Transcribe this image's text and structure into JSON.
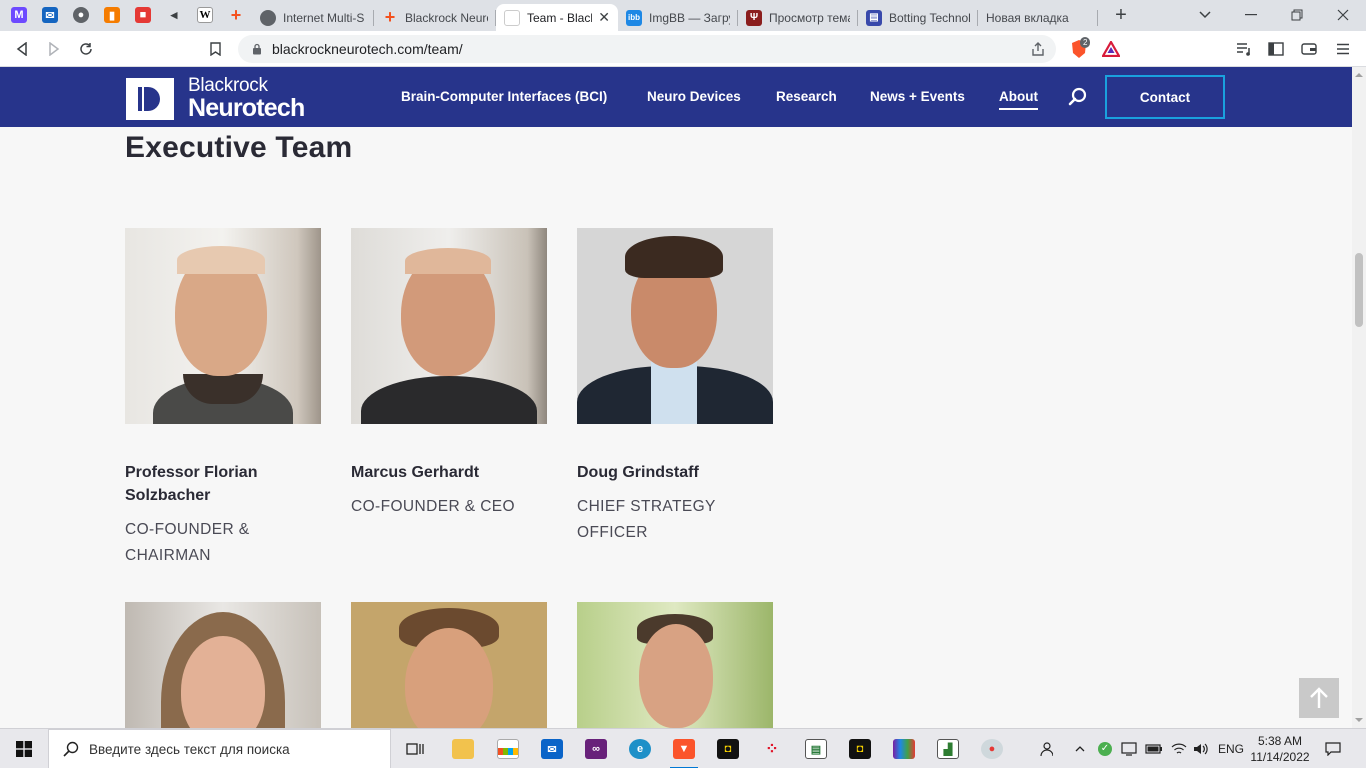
{
  "browser": {
    "pinned_tabs": [
      {
        "icon": "proton-mail-icon",
        "color": "#6d4aff",
        "glyph": "M"
      },
      {
        "icon": "mail-icon",
        "color": "#1565c0",
        "glyph": "✉"
      },
      {
        "icon": "globe-icon",
        "color": "#5f6368",
        "glyph": "●"
      },
      {
        "icon": "analytics-icon",
        "color": "#f57c00",
        "glyph": "▮"
      },
      {
        "icon": "gift-icon",
        "color": "#e53935",
        "glyph": "■"
      },
      {
        "icon": "speaker-icon",
        "color": "#3c4043",
        "glyph": "◂"
      },
      {
        "icon": "wikipedia-icon",
        "color": "#ffffff",
        "glyph": "W"
      },
      {
        "icon": "plus-cross-icon",
        "color": "#f4511e",
        "glyph": "+"
      }
    ],
    "tabs": [
      {
        "title": "Internet Multi-S",
        "icon": "globe-icon",
        "color": "#5f6368",
        "glyph": "●",
        "active": false
      },
      {
        "title": "Blackrock Neuro",
        "icon": "plus-cross-icon",
        "color": "#f4511e",
        "glyph": "+",
        "active": false
      },
      {
        "title": "Team - Black",
        "icon": "blackrock-icon",
        "color": "#ffffff",
        "glyph": "",
        "active": true,
        "close": "✕"
      },
      {
        "title": "ImgBB — Загру",
        "icon": "imgbb-icon",
        "color": "#1e88e5",
        "glyph": "ibb",
        "active": false
      },
      {
        "title": "Просмотр тема",
        "icon": "trident-icon",
        "color": "#8b1e1e",
        "glyph": "Ψ",
        "active": false
      },
      {
        "title": "Botting Technol",
        "icon": "botting-icon",
        "color": "#3949ab",
        "glyph": "▤",
        "active": false
      },
      {
        "title": "Новая вкладка",
        "icon": "",
        "color": "",
        "glyph": "",
        "active": false
      }
    ],
    "new_tab": "+",
    "url": "blackrockneurotech.com/team/",
    "brave_badge": "2"
  },
  "site": {
    "logo_line1": "Blackrock",
    "logo_line2": "Neurotech",
    "nav": [
      {
        "label": "Brain-Computer Interfaces (BCI)",
        "active": false
      },
      {
        "label": "Neuro Devices",
        "active": false
      },
      {
        "label": "Research",
        "active": false
      },
      {
        "label": "News + Events",
        "active": false
      },
      {
        "label": "About",
        "active": true
      }
    ],
    "contact": "Contact",
    "accent": "#27348b",
    "button_border": "#1aa1dd"
  },
  "section": {
    "title": "Executive Team"
  },
  "team": [
    {
      "name": "Professor Florian Solzbacher",
      "role": "CO-FOUNDER & CHAIRMAN"
    },
    {
      "name": "Marcus Gerhardt",
      "role": "CO-FOUNDER & CEO"
    },
    {
      "name": "Doug Grindstaff",
      "role": "CHIEF STRATEGY OFFICER"
    }
  ],
  "taskbar": {
    "search_placeholder": "Введите здесь текст для поиска",
    "language": "ENG",
    "time": "5:38 AM",
    "date": "11/14/2022"
  }
}
